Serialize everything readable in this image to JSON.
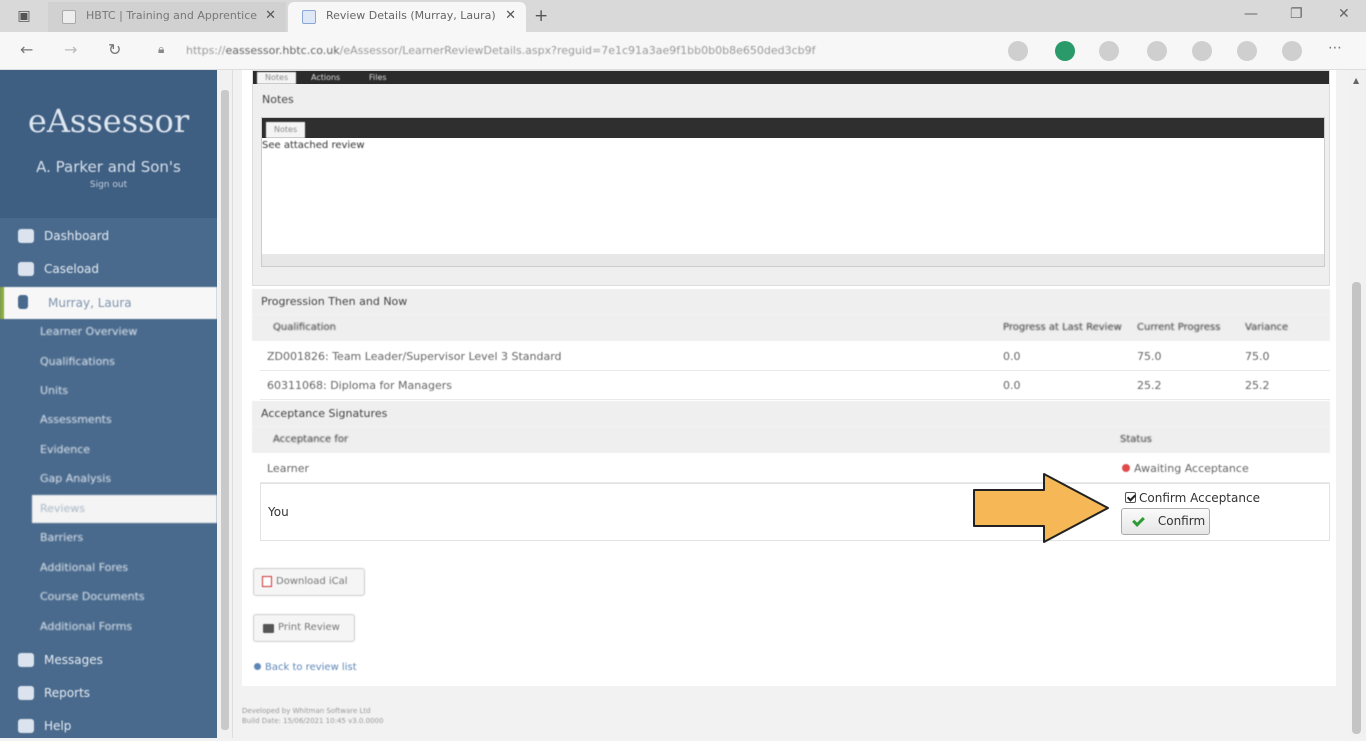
{
  "browser": {
    "tabs": [
      {
        "label": "HBTC | Training and Apprentice"
      },
      {
        "label": "Review Details (Murray, Laura)"
      }
    ],
    "new_tab": "+",
    "close": "✕",
    "url_host": "eassessor.hbtc.co.uk",
    "url_prefix": "https://",
    "url_path": "/eAssessor/LearnerReviewDetails.aspx?reguid=7e1c91a3ae9f1bb0b0b8e650ded3cb9f",
    "window_controls": [
      "—",
      "❐",
      "✕"
    ]
  },
  "sidebar": {
    "app_name": "eAssessor",
    "org_name": "A. Parker and Son's",
    "signout": "Sign out",
    "items": [
      {
        "label": "Dashboard",
        "icon": "dashboard-icon"
      },
      {
        "label": "Caseload",
        "icon": "caseload-icon"
      },
      {
        "label": "Murray, Laura",
        "icon": "person-icon"
      }
    ],
    "sub_items": [
      "Learner Overview",
      "Qualifications",
      "Units",
      "Assessments",
      "Evidence",
      "Gap Analysis",
      "Reviews",
      "Barriers",
      "Additional Fores",
      "Course Documents",
      "Additional Forms"
    ],
    "bottom_items": [
      {
        "label": "Messages",
        "icon": "messages-icon"
      },
      {
        "label": "Reports",
        "icon": "reports-icon"
      },
      {
        "label": "Help",
        "icon": "help-icon"
      }
    ]
  },
  "notes": {
    "tabs": [
      "Notes",
      "Actions",
      "Files"
    ],
    "heading": "Notes",
    "editor_tab": "Notes",
    "content": "See attached review"
  },
  "progression": {
    "heading": "Progression Then and Now",
    "columns": [
      "Qualification",
      "Progress at Last Review",
      "Current Progress",
      "Variance"
    ],
    "rows": [
      [
        "ZD001826: Team Leader/Supervisor Level 3 Standard",
        "0.0",
        "75.0",
        "75.0"
      ],
      [
        "60311068: Diploma for Managers",
        "0.0",
        "25.2",
        "25.2"
      ]
    ]
  },
  "acceptance": {
    "heading": "Acceptance Signatures",
    "columns": [
      "Acceptance for",
      "Status"
    ],
    "rows": [
      {
        "for": "Learner",
        "status": "Awaiting Acceptance"
      }
    ],
    "you_label": "You",
    "confirm_checkbox_label": "Confirm Acceptance",
    "confirm_button": "Confirm"
  },
  "actions": {
    "download": "Download iCal",
    "print": "Print Review",
    "back": "Back to review list"
  },
  "footer": {
    "line1": "Developed by Whitman Software Ltd",
    "line2": "Build Date: 15/06/2021 10:45 v3.0.0000"
  },
  "colors": {
    "sidebar": "#4a6a8d",
    "arrow": "#f6b756",
    "active_accent": "#8cab3c"
  }
}
